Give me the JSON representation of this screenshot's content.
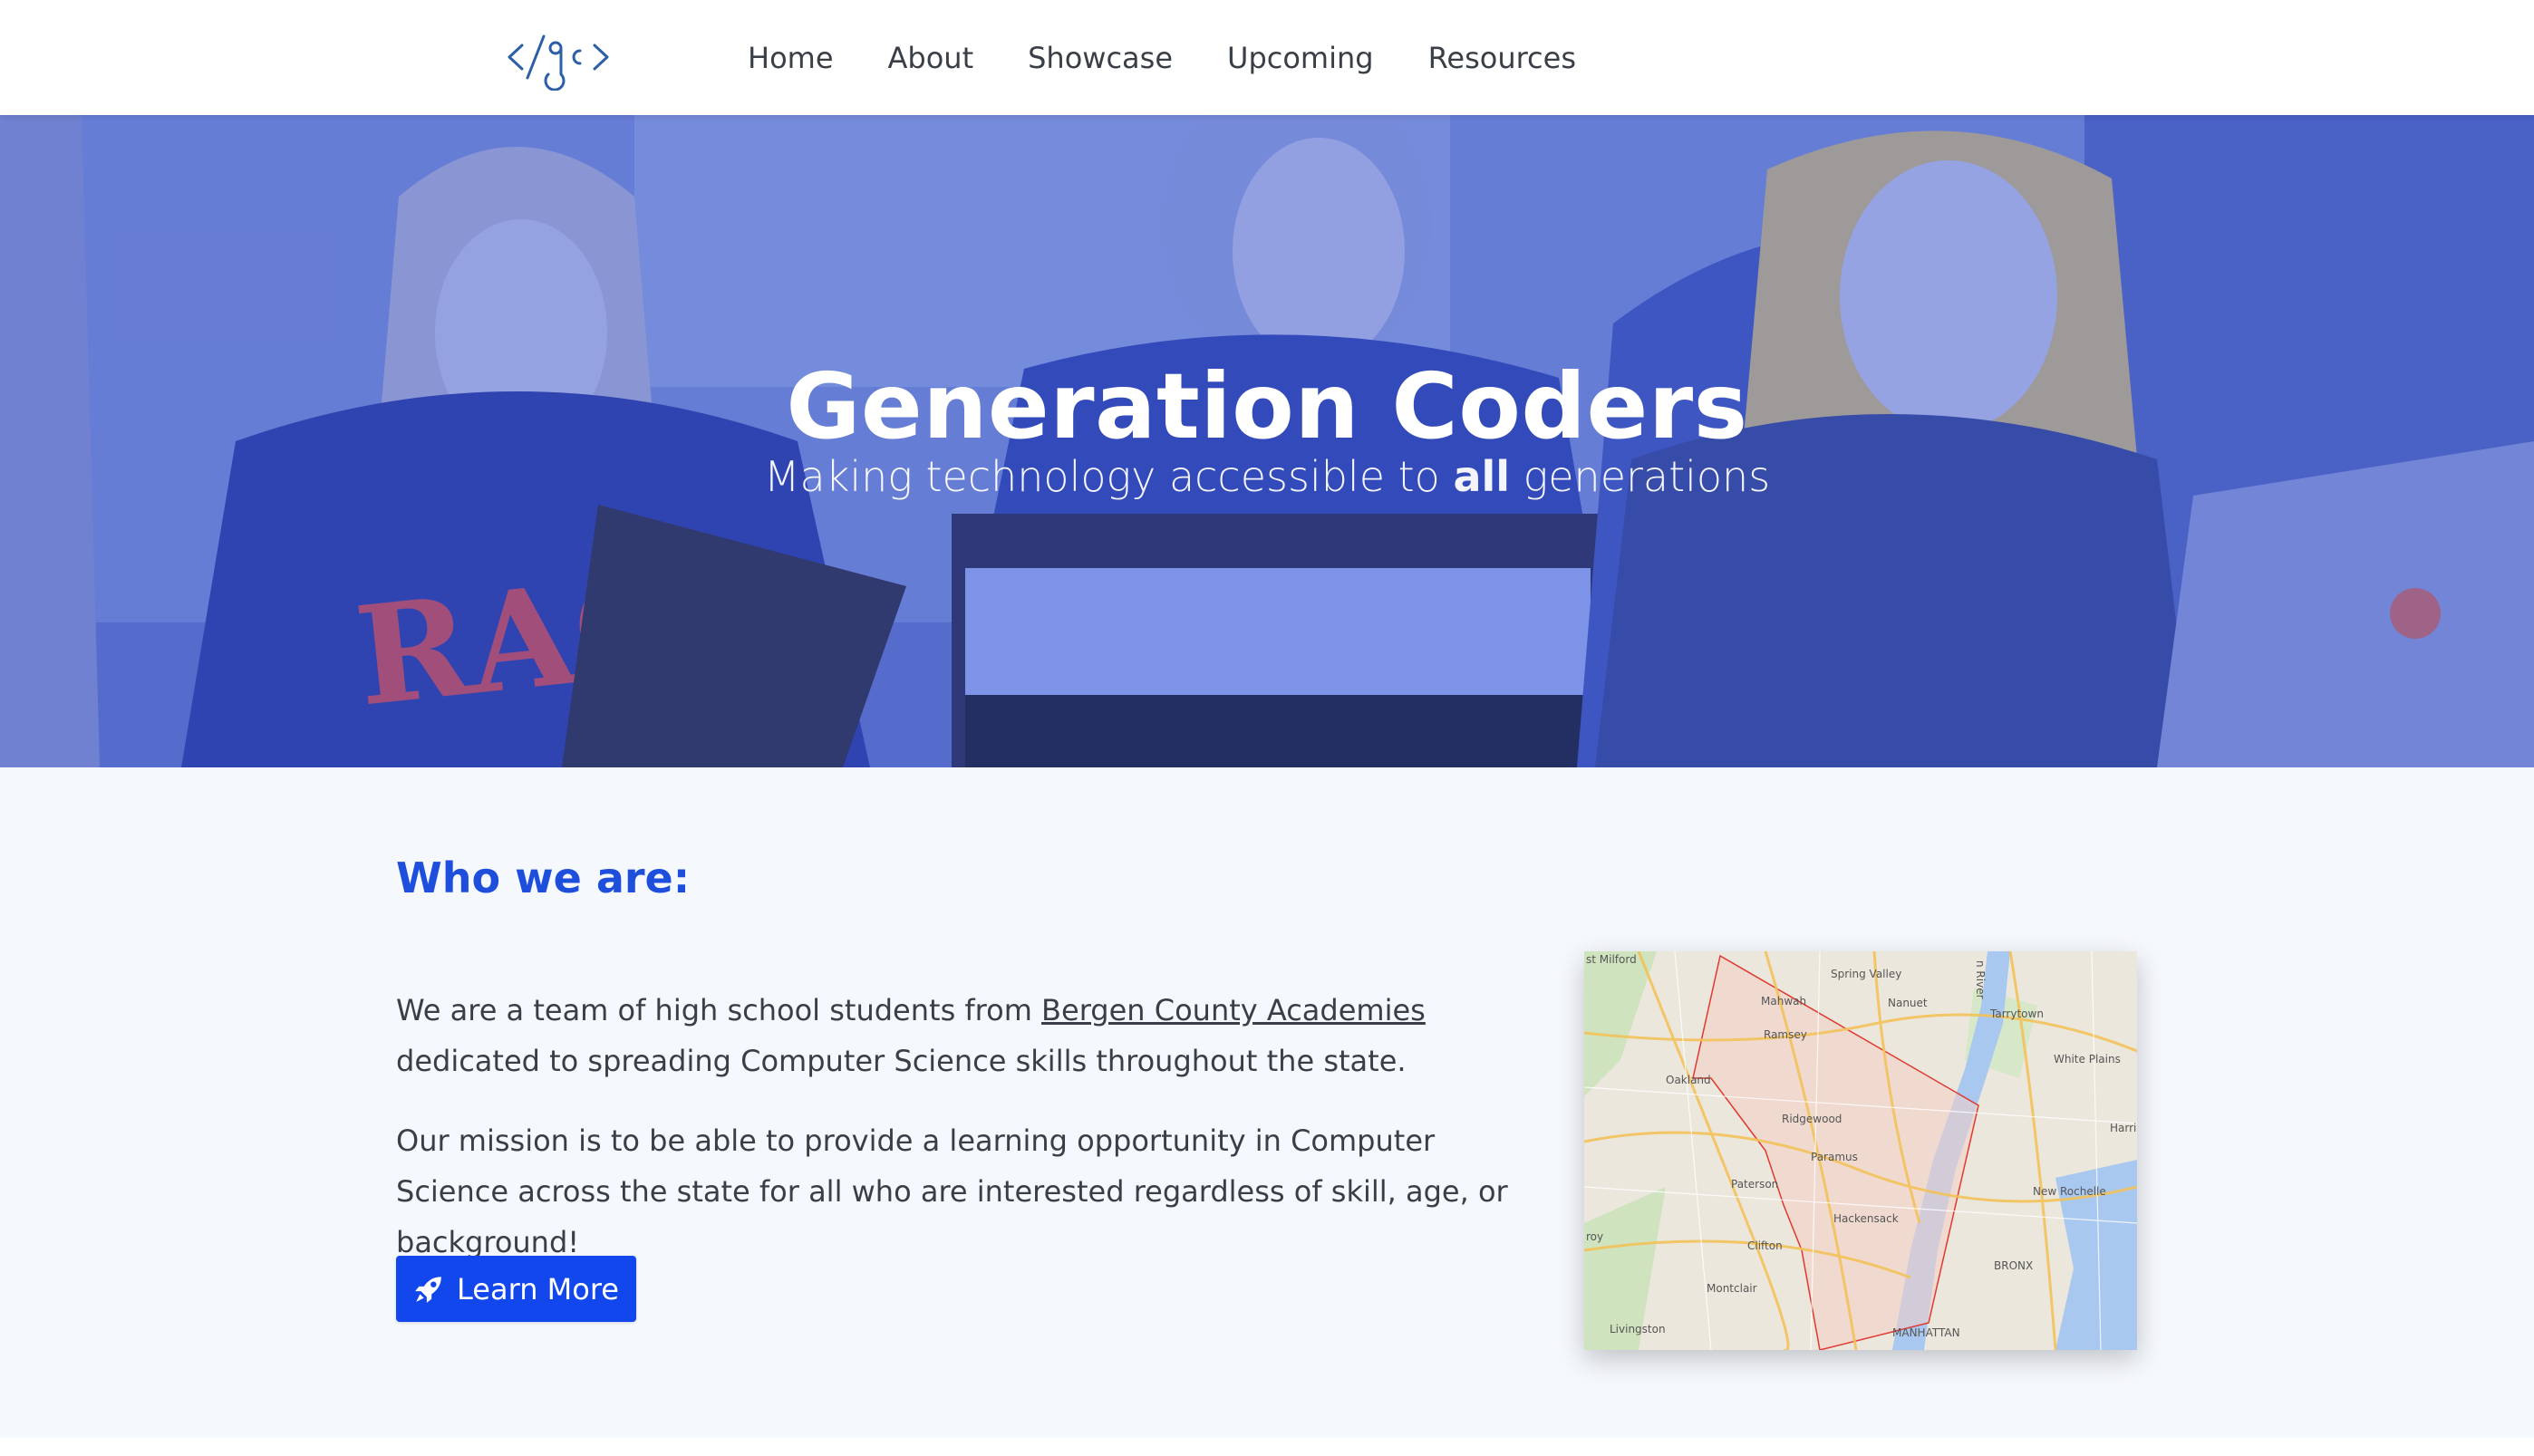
{
  "nav": {
    "logo_icon": "code-gc-logo",
    "links": [
      {
        "label": "Home"
      },
      {
        "label": "About"
      },
      {
        "label": "Showcase"
      },
      {
        "label": "Upcoming"
      },
      {
        "label": "Resources"
      }
    ]
  },
  "hero": {
    "title": "Generation Coders",
    "subtitle_before": "Making technology accessible to ",
    "subtitle_emphasis": "all",
    "subtitle_after": " generations",
    "overlay_color": "#4a61c3"
  },
  "about": {
    "heading": "Who we are:",
    "paragraph1_before": "We are a team of high school students from ",
    "paragraph1_link": "Bergen County Academies",
    "paragraph1_after": " dedicated to spreading Computer Science skills throughout the state.",
    "paragraph2": "Our mission is to be able to provide a learning opportunity in Computer Science across the state for all who are interested regardless of skill, age, or background!",
    "button_label": "Learn More",
    "button_icon": "rocket-icon",
    "button_color": "#1347ee",
    "heading_color": "#1e4fdc"
  },
  "map": {
    "labels": [
      "st Milford",
      "Mahwah",
      "Spring Valley",
      "Nanuet",
      "Tarrytown",
      "Ramsey",
      "Oakland",
      "White Plains",
      "Ridgewood",
      "Paramus",
      "Paterson",
      "Hackensack",
      "Clifton",
      "New Rochelle",
      "Montclair",
      "Livingston",
      "MANHATTAN",
      "BRONX",
      "Harris",
      "roy",
      "n River"
    ]
  }
}
